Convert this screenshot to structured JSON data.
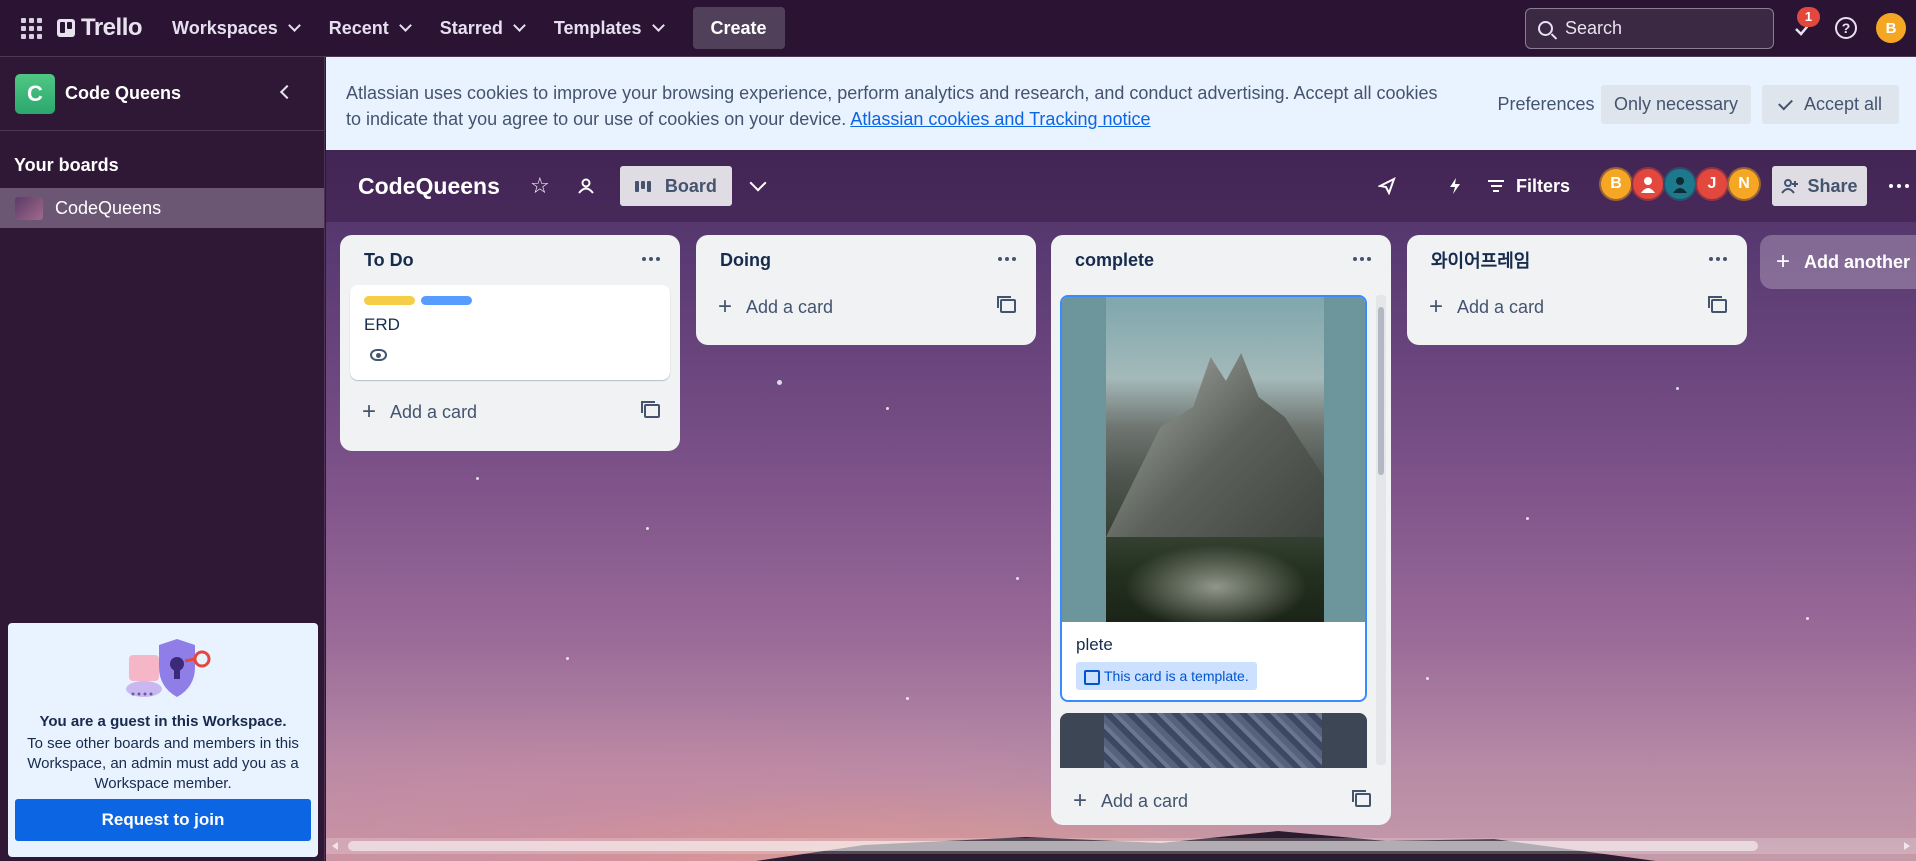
{
  "topbar": {
    "logo": "Trello",
    "nav": [
      "Workspaces",
      "Recent",
      "Starred",
      "Templates"
    ],
    "create_label": "Create",
    "search_placeholder": "Search",
    "notifications_count": "1",
    "user_initial": "B"
  },
  "sidebar": {
    "workspace_initial": "C",
    "workspace_name": "Code Queens",
    "boards_heading": "Your boards",
    "boards": [
      {
        "name": "CodeQueens"
      }
    ],
    "guest": {
      "title": "You are a guest in this Workspace.",
      "body": "To see other boards and members in this Workspace, an admin must add you as a Workspace member.",
      "button": "Request to join"
    }
  },
  "cookie_banner": {
    "text": "Atlassian uses cookies to improve your browsing experience, perform analytics and research, and conduct advertising. Accept all cookies to indicate that you agree to our use of cookies on your device.",
    "link": "Atlassian cookies and Tracking notice",
    "preferences": "Preferences",
    "only_necessary": "Only necessary",
    "accept_all": "Accept all"
  },
  "board": {
    "title": "CodeQueens",
    "view_label": "Board",
    "filters_label": "Filters",
    "share_label": "Share",
    "members": [
      {
        "initial": "B",
        "color": "#f5a623"
      },
      {
        "initial": "",
        "color": "#e2483d"
      },
      {
        "initial": "",
        "color": "#1d7a8c"
      },
      {
        "initial": "J",
        "color": "#e2483d"
      },
      {
        "initial": "N",
        "color": "#f5a623"
      }
    ]
  },
  "lists": [
    {
      "name": "To Do",
      "cards": [
        {
          "title": "ERD",
          "labels": [
            "#f5cd47",
            "#579dff"
          ]
        }
      ],
      "add_card": "Add a card"
    },
    {
      "name": "Doing",
      "cards": [],
      "add_card": "Add a card"
    },
    {
      "name": "complete",
      "cards": [
        {
          "title": "plete",
          "template_badge": "This card is a template."
        }
      ],
      "add_card": "Add a card"
    },
    {
      "name": "와이어프레임",
      "cards": [],
      "add_card": "Add a card"
    }
  ],
  "add_list_label": "Add another li"
}
